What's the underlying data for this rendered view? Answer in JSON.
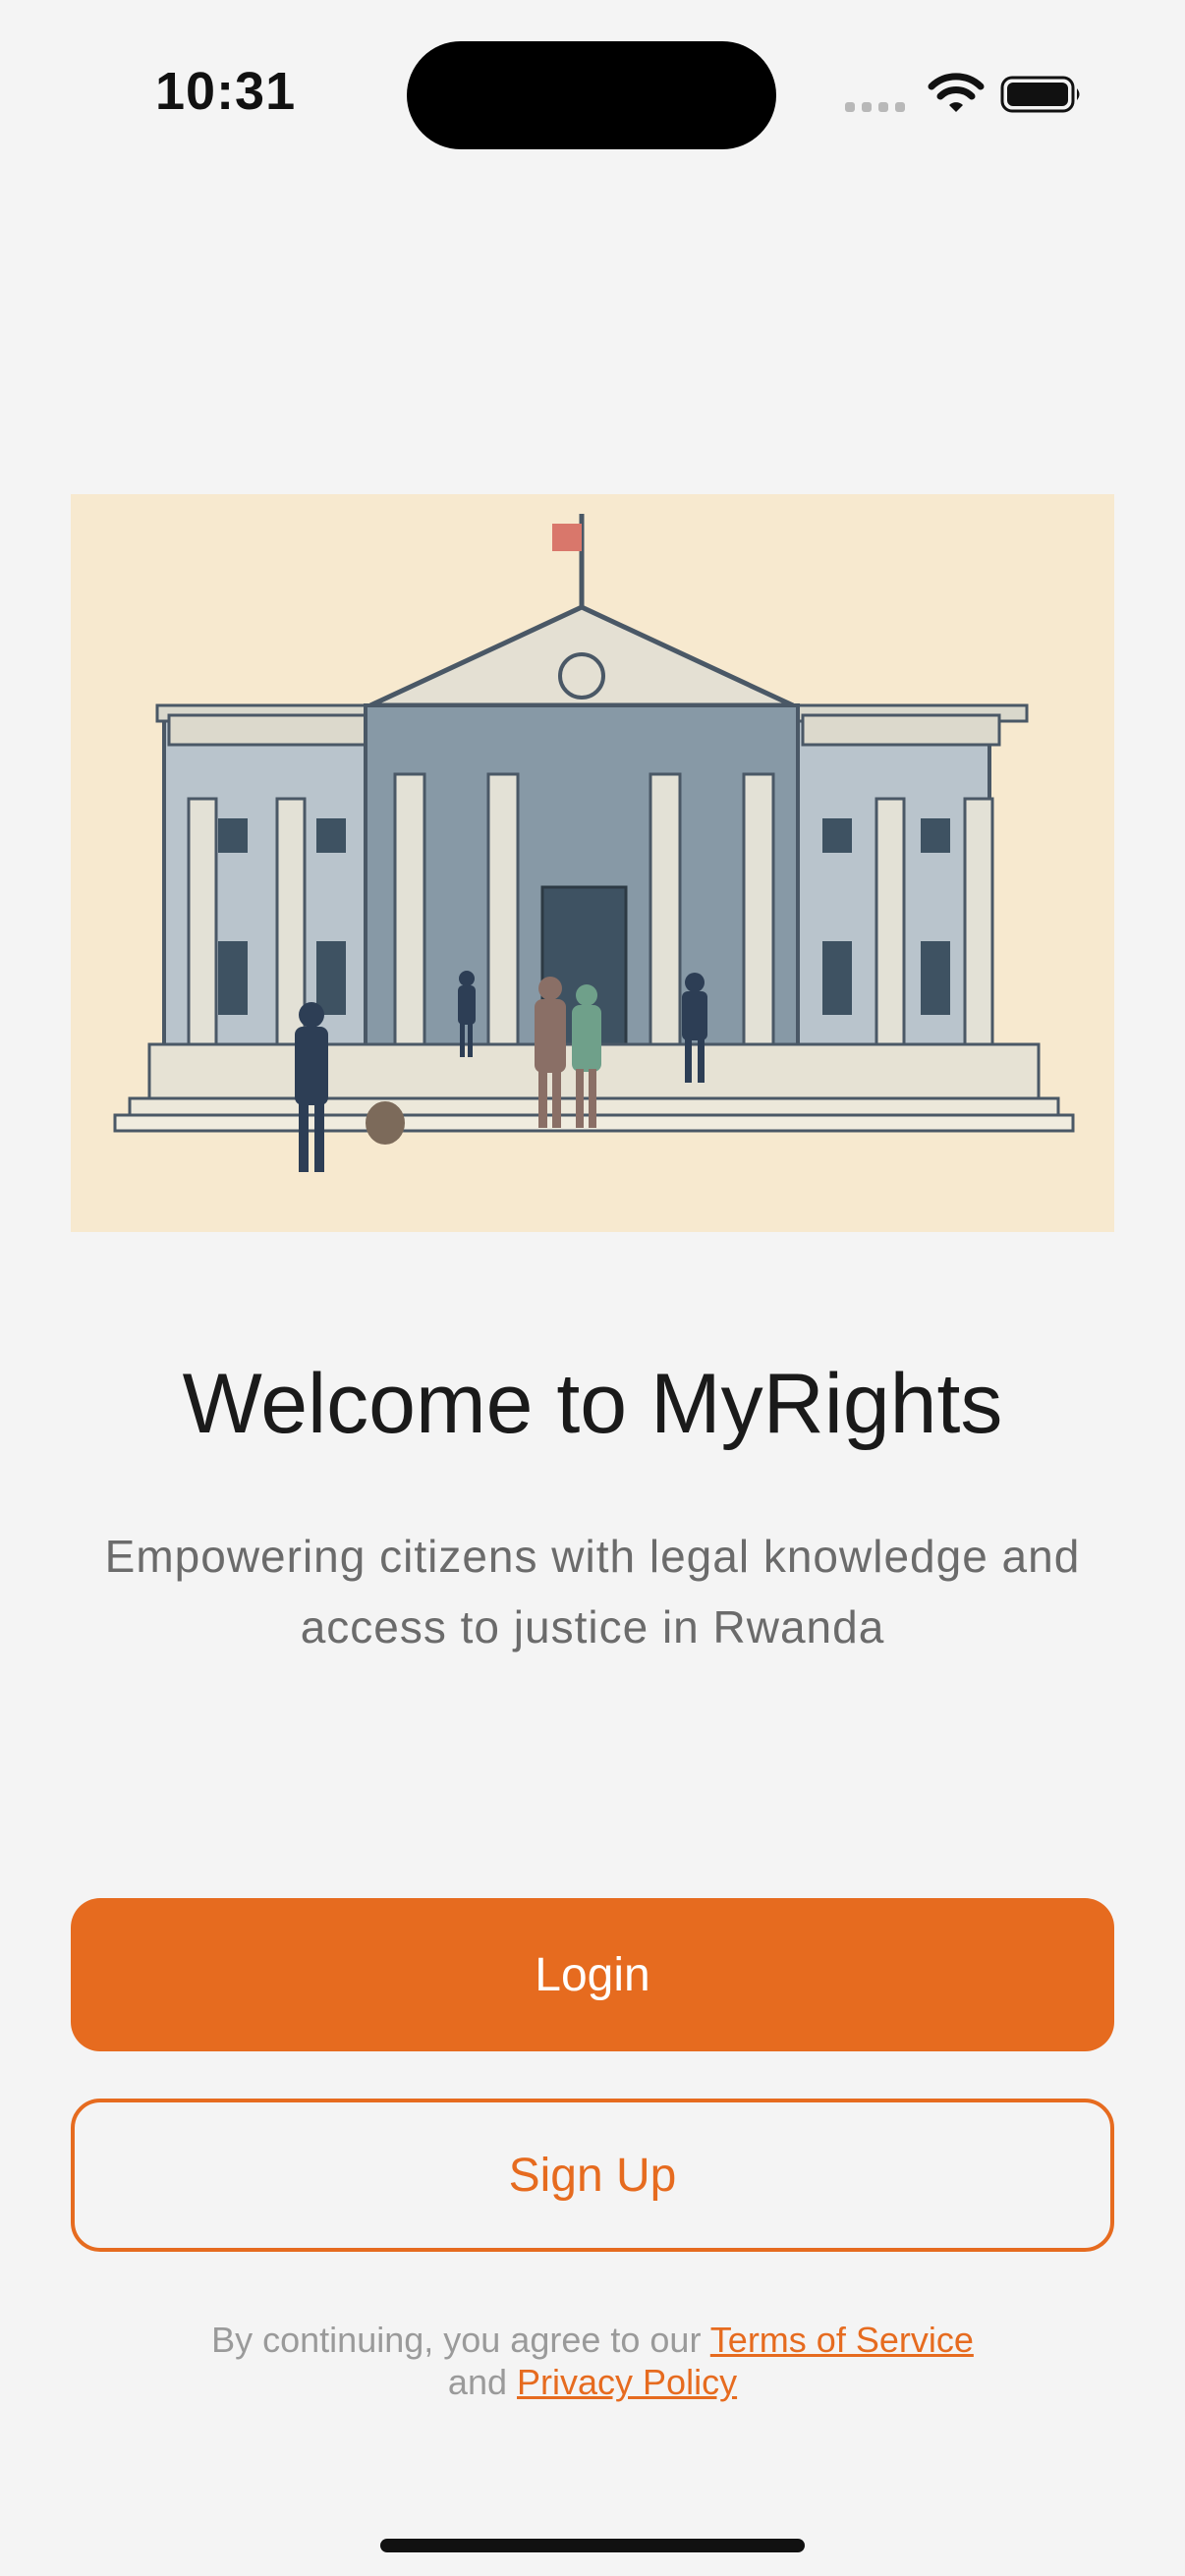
{
  "status_bar": {
    "time": "10:31"
  },
  "hero": {
    "illustration": "courthouse-with-people",
    "background_color": "#f7e9cf"
  },
  "welcome": {
    "title": "Welcome to MyRights",
    "subtitle": "Empowering citizens with legal knowledge and access to justice in Rwanda"
  },
  "actions": {
    "login_label": "Login",
    "signup_label": "Sign Up"
  },
  "legal": {
    "prefix": "By continuing, you agree to our",
    "terms_label": "Terms of Service",
    "and_text": "and",
    "privacy_label": "Privacy Policy"
  },
  "colors": {
    "accent": "#e66b1f",
    "background": "#f4f4f4",
    "title": "#1a1a1a",
    "subtitle": "#6b6b6b"
  },
  "icons": [
    "signal-icon",
    "wifi-icon",
    "battery-icon"
  ]
}
